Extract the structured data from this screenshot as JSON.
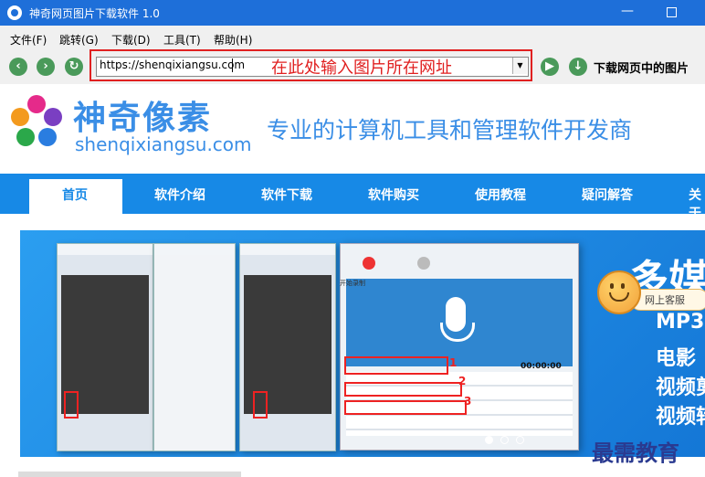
{
  "window": {
    "title": "神奇网页图片下载软件 1.0",
    "minimize": "—",
    "maximize": ""
  },
  "menu": [
    "文件(F)",
    "跳转(G)",
    "下载(D)",
    "工具(T)",
    "帮助(H)"
  ],
  "toolbar": {
    "url_value": "https://shenqixiangsu.com",
    "annotation": "在此处输入图片所在网址",
    "download_label": "下载网页中的图片"
  },
  "site": {
    "brand_cn": "神奇像素",
    "brand_en": "shenqixiangsu.com",
    "slogan": "专业的计算机工具和管理软件开发商",
    "nav": [
      "首页",
      "软件介绍",
      "软件下载",
      "软件购买",
      "使用教程",
      "疑问解答",
      "关于"
    ]
  },
  "banner": {
    "heading": "多媒",
    "lines": [
      "MP3",
      "电影",
      "视频剪",
      "视频转"
    ],
    "rec_label": "开始录制",
    "time": "00:00:00",
    "slides": 3,
    "active_slide": 0
  },
  "customer_service": {
    "label": "网上客服"
  },
  "watermark": "最需教育",
  "colors": {
    "titlebar": "#1e6fd9",
    "nav": "#1789e6",
    "brand": "#3a8ee6",
    "annotation": "#e02020"
  }
}
